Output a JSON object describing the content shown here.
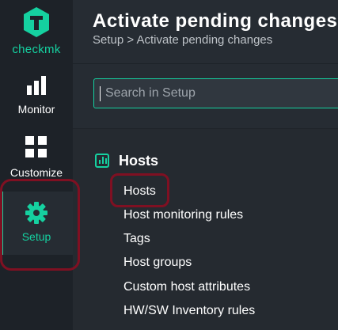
{
  "brand": {
    "name": "checkmk",
    "accent_color": "#15d1a0"
  },
  "sidebar": {
    "items": [
      {
        "label": "Monitor",
        "icon": "bar-chart-icon",
        "active": false
      },
      {
        "label": "Customize",
        "icon": "grid-icon",
        "active": false
      },
      {
        "label": "Setup",
        "icon": "gear-icon",
        "active": true
      }
    ]
  },
  "header": {
    "title": "Activate pending changes",
    "breadcrumb": "Setup > Activate pending changes"
  },
  "search": {
    "placeholder": "Search in Setup",
    "value": ""
  },
  "main": {
    "section": {
      "title": "Hosts",
      "icon": "hosts-section-icon",
      "items": [
        {
          "label": "Hosts"
        },
        {
          "label": "Host monitoring rules"
        },
        {
          "label": "Tags"
        },
        {
          "label": "Host groups"
        },
        {
          "label": "Custom host attributes"
        },
        {
          "label": "HW/SW Inventory rules"
        }
      ]
    }
  },
  "annotations": {
    "highlight_color": "#7f1022"
  }
}
